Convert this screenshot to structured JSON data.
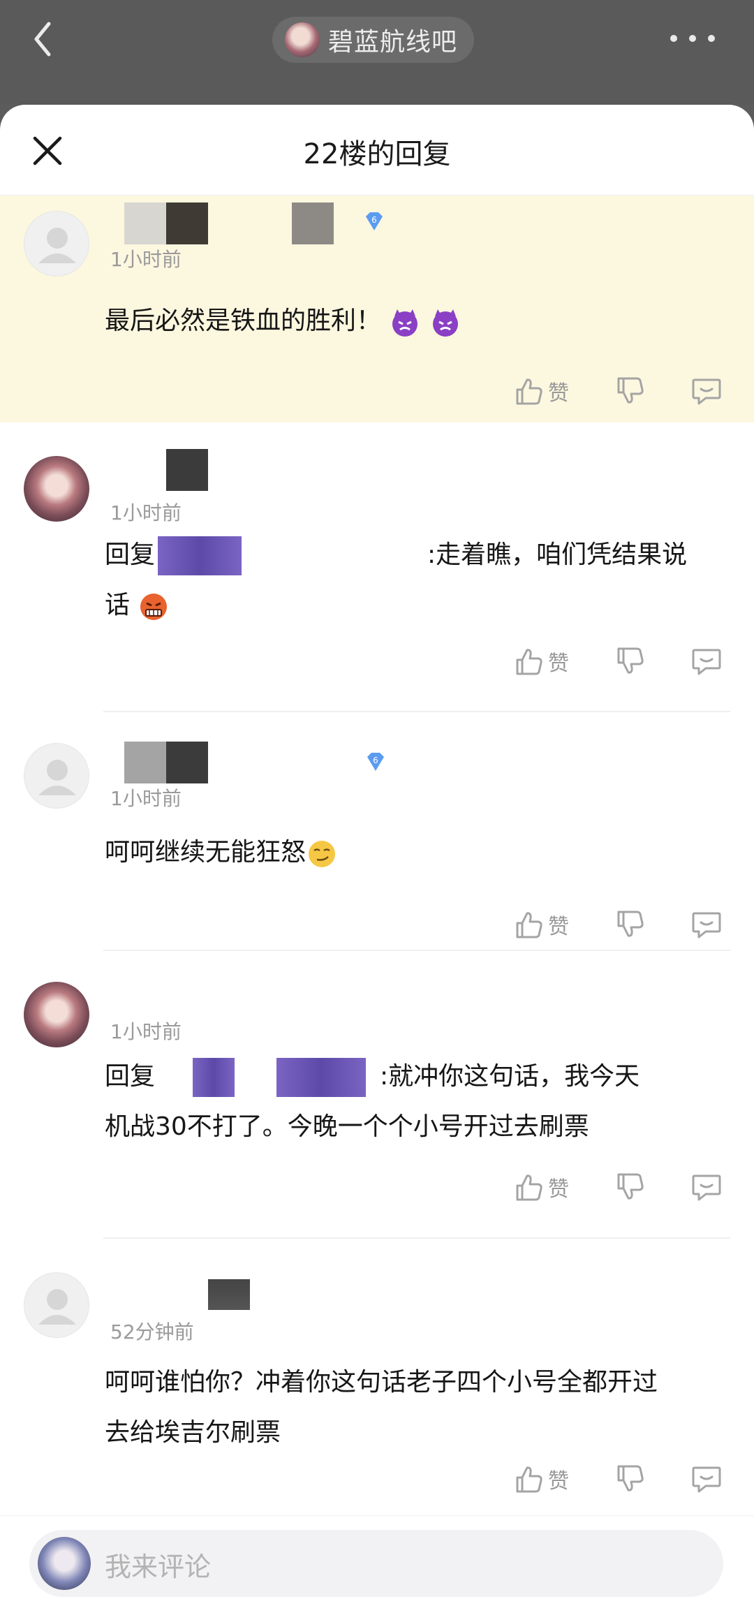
{
  "topbar": {
    "forum_name": "碧蓝航线吧"
  },
  "sheet": {
    "title": "22楼的回复"
  },
  "actions": {
    "like_label": "赞"
  },
  "comments": [
    {
      "level": "6",
      "time": "1小时前",
      "text": "最后必然是铁血的胜利！",
      "emojis": [
        "angry-devil-emoji",
        "angry-devil-emoji"
      ]
    },
    {
      "time": "1小时前",
      "reply_prefix": "回复",
      "text_after_mention": ":走着瞧，咱们凭结果说",
      "text_line2": "话",
      "emojis": [
        "grimacing-angry-emoji"
      ]
    },
    {
      "level": "6",
      "time": "1小时前",
      "text": "呵呵继续无能狂怒",
      "emojis": [
        "smirk-emoji"
      ]
    },
    {
      "time": "1小时前",
      "reply_prefix": "回复",
      "text_after_mention": ":就冲你这句话，我今天",
      "text_line2": "机战30不打了。今晚一个个小号开过去刷票"
    },
    {
      "time": "52分钟前",
      "text_line1": "呵呵谁怕你？冲着你这句话老子四个小号全都开过",
      "text_line2": "去给埃吉尔刷票"
    }
  ],
  "composer": {
    "placeholder": "我来评论"
  }
}
